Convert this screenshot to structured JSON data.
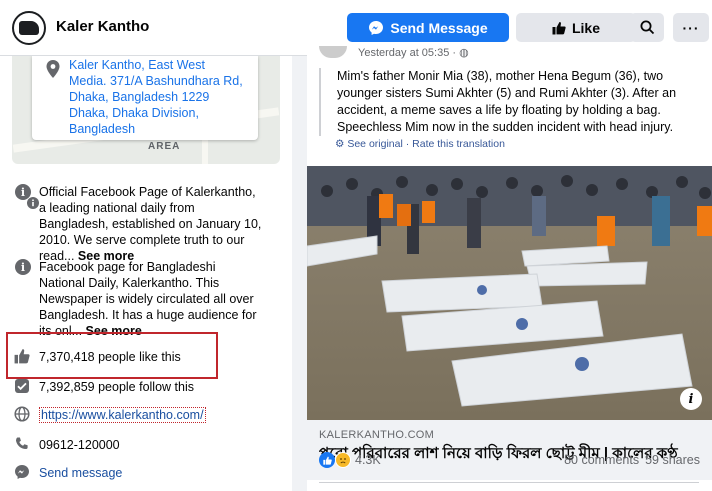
{
  "header": {
    "page_name": "Kaler Kantho",
    "send_message_label": "Send Message",
    "like_label": "Like",
    "more_label": "···"
  },
  "sidebar": {
    "map": {
      "address": "Kaler Kantho, East West Media. 371/A Bashundhara Rd, Dhaka, Bangladesh 1229 Dhaka, Dhaka Division, Bangladesh",
      "area_label": "AREA"
    },
    "about_items": [
      {
        "text": "Official Facebook Page of Kalerkantho, a leading national daily from Bangladesh, established on January 10, 2010. We serve complete truth to our read... ",
        "see_more": "See more"
      },
      {
        "text": "Facebook page for Bangladeshi National Daily, Kalerkantho. This Newspaper is widely circulated all over Bangladesh. It has a huge audience for its onl... ",
        "see_more": "See more"
      }
    ],
    "likes": "7,370,418 people like this",
    "follows": "7,392,859 people follow this",
    "website": "https://www.kalerkantho.com/",
    "phone": "09612-120000",
    "message": "Send message"
  },
  "post": {
    "time": "Yesterday at 05:35 · ",
    "text": "Mim's father Monir Mia (38), mother Hena Begum (36), two younger sisters Sumi Akhter (5) and Rumi Akhter (3). After an accident, a meme saves a life by floating by holding a bag. Speechless Mim now in the sudden incident with head injury.",
    "see_original": "See original",
    "separator": " · ",
    "rate_translation": "Rate this translation",
    "link_domain": "KALERKANTHO.COM",
    "link_title": "পুরো পরিবারের লাশ নিয়ে বাড়ি ফিরল ছোট্ট মীম | কালের কণ্ঠ",
    "reaction_count": "4.3K",
    "comments": "80 comments",
    "shares": "59 shares"
  },
  "colors": {
    "accent": "#1877f2",
    "highlight_border": "#c0262c",
    "link": "#1a4fa0"
  }
}
